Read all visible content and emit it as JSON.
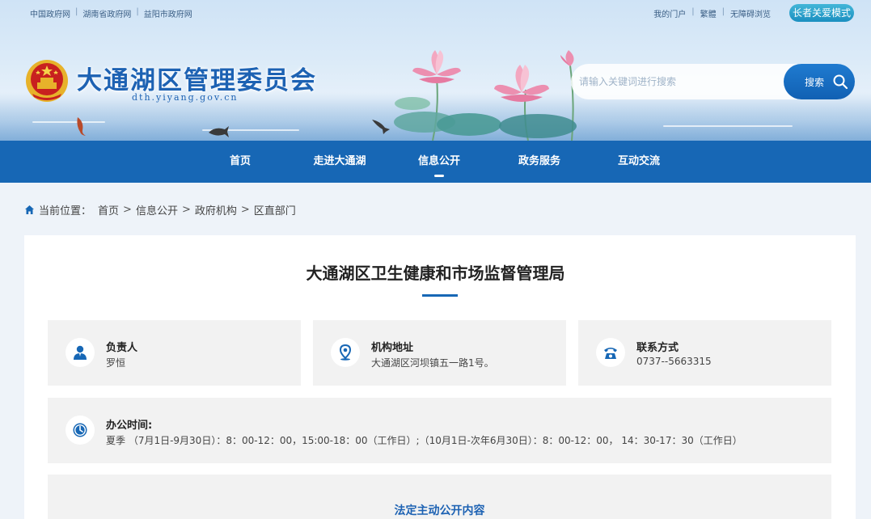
{
  "top_links": [
    "中国政府网",
    "湖南省政府网",
    "益阳市政府网"
  ],
  "right_links": [
    "我的门户",
    "繁體",
    "无障碍浏览"
  ],
  "elder_mode_label": "长者关爱模式",
  "site": {
    "title": "大通湖区管理委员会",
    "domain": "dth.yiyang.gov.cn"
  },
  "search": {
    "placeholder": "请输入关键词进行搜索",
    "button_label": "搜索"
  },
  "nav": [
    {
      "label": "首页",
      "active": false
    },
    {
      "label": "走进大通湖",
      "active": false
    },
    {
      "label": "信息公开",
      "active": true
    },
    {
      "label": "政务服务",
      "active": false
    },
    {
      "label": "互动交流",
      "active": false
    }
  ],
  "breadcrumb": {
    "prefix": "当前位置：",
    "items": [
      "首页",
      "信息公开",
      "政府机构",
      "区直部门"
    ],
    "separator": ">"
  },
  "department": {
    "title": "大通湖区卫生健康和市场监督管理局",
    "leader_label": "负责人",
    "leader_value": "罗恒",
    "address_label": "机构地址",
    "address_value": "大通湖区河坝镇五一路1号。",
    "contact_label": "联系方式",
    "contact_value": "0737--5663315",
    "hours_label": "办公时间:",
    "hours_value": "夏季 （7月1日-9月30日）：8：00-12：00，15:00-18：00（工作日）;（10月1日-次年6月30日）：8：00-12：00， 14：30-17：30（工作日）",
    "section_title": "法定主动公开内容"
  },
  "colors": {
    "nav_bg": "#1767b5",
    "title_blue": "#1d62b3",
    "elder_btn": "#1b8fc0"
  },
  "icons": [
    "national-emblem-icon",
    "search-icon",
    "home-icon",
    "person-icon",
    "location-pin-icon",
    "telephone-icon",
    "clock-icon"
  ]
}
